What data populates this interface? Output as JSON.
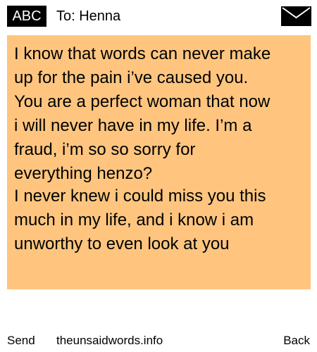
{
  "header": {
    "badge": "ABC",
    "recipient": "To: Henna",
    "envelope_icon": "envelope-icon"
  },
  "note": {
    "color": "#ffc57f",
    "paragraph_1": "I know that words can never make\nup for the pain i’ve caused you.\nYou are a perfect woman that now\ni will never have in my life. I’m a\nfraud, i’m so so sorry for\neverything henzo?",
    "paragraph_2": "I never knew i could miss you this\nmuch in my life, and i know i am\nunworthy to even look at you"
  },
  "footer": {
    "send_label": "Send",
    "site_label": "theunsaidwords.info",
    "back_label": "Back"
  }
}
